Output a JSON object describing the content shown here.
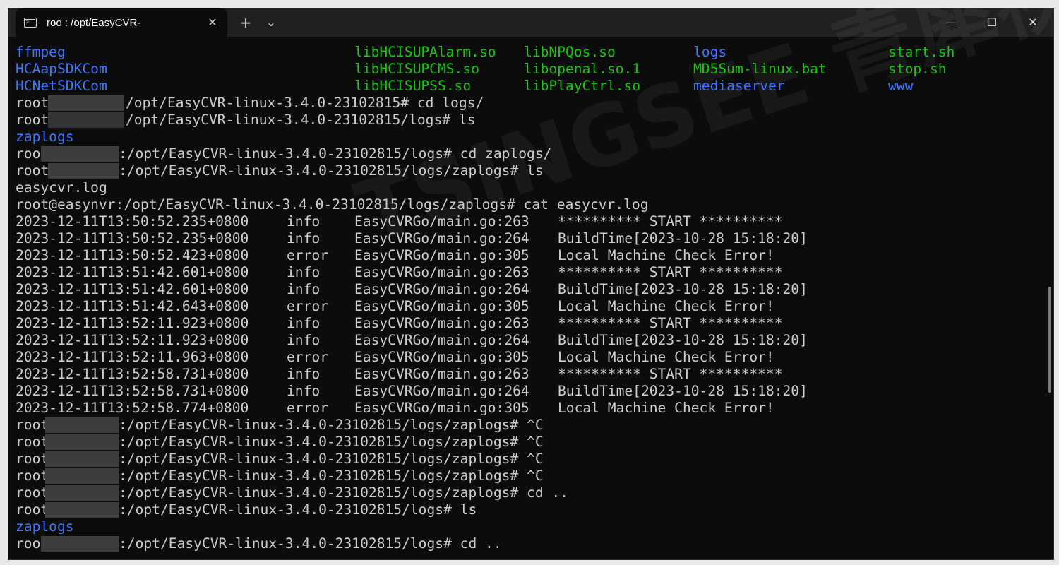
{
  "window": {
    "tab_title": "roo         : /opt/EasyCVR-",
    "new_tab": "+",
    "dropdown": "⌄",
    "tab_close": "✕",
    "minimize": "—",
    "maximize": "☐",
    "close": "✕"
  },
  "colors": {
    "background": "#0c0c0c",
    "titlebar": "#202020",
    "executable": "#16c60c",
    "directory": "#3b78ff",
    "text": "#cccccc"
  },
  "listing": [
    [
      "ffmpeg",
      "libHCISUPAlarm.so",
      "libNPQos.so",
      "logs",
      "start.sh"
    ],
    [
      "HCAapSDKCom",
      "libHCISUPCMS.so",
      "libopenal.so.1",
      "MD5Sum-linux.bat",
      "stop.sh"
    ],
    [
      "HCNetSDKCom",
      "libHCISUPSS.so",
      "libPlayCtrl.so",
      "mediaserver",
      "www"
    ]
  ],
  "prompt_lines_a": [
    {
      "user": "root",
      "rest": "/opt/EasyCVR-linux-3.4.0-23102815# cd logs/"
    },
    {
      "user": "root",
      "rest": "/opt/EasyCVR-linux-3.4.0-23102815/logs# ls"
    }
  ],
  "dir_zaplogs": "zaplogs",
  "prompt_lines_b": [
    {
      "user": "roo",
      "rest": ":/opt/EasyCVR-linux-3.4.0-23102815/logs# cd zaplogs/"
    },
    {
      "user": "root",
      "rest": ":/opt/EasyCVR-linux-3.4.0-23102815/logs/zaplogs# ls"
    }
  ],
  "file_easycvr": "easycvr.log",
  "cat_line": "root@easynvr:/opt/EasyCVR-linux-3.4.0-23102815/logs/zaplogs# cat easycvr.log",
  "log_entries": [
    {
      "ts": "2023-12-11T13:50:52.235+0800",
      "level": "info",
      "src": "EasyCVRGo/main.go:263",
      "msg": "********** START **********"
    },
    {
      "ts": "2023-12-11T13:50:52.235+0800",
      "level": "info",
      "src": "EasyCVRGo/main.go:264",
      "msg": "BuildTime[2023-10-28 15:18:20]"
    },
    {
      "ts": "2023-12-11T13:50:52.423+0800",
      "level": "error",
      "src": "EasyCVRGo/main.go:305",
      "msg": "Local Machine Check Error!"
    },
    {
      "ts": "2023-12-11T13:51:42.601+0800",
      "level": "info",
      "src": "EasyCVRGo/main.go:263",
      "msg": "********** START **********"
    },
    {
      "ts": "2023-12-11T13:51:42.601+0800",
      "level": "info",
      "src": "EasyCVRGo/main.go:264",
      "msg": "BuildTime[2023-10-28 15:18:20]"
    },
    {
      "ts": "2023-12-11T13:51:42.643+0800",
      "level": "error",
      "src": "EasyCVRGo/main.go:305",
      "msg": "Local Machine Check Error!"
    },
    {
      "ts": "2023-12-11T13:52:11.923+0800",
      "level": "info",
      "src": "EasyCVRGo/main.go:263",
      "msg": "********** START **********"
    },
    {
      "ts": "2023-12-11T13:52:11.923+0800",
      "level": "info",
      "src": "EasyCVRGo/main.go:264",
      "msg": "BuildTime[2023-10-28 15:18:20]"
    },
    {
      "ts": "2023-12-11T13:52:11.963+0800",
      "level": "error",
      "src": "EasyCVRGo/main.go:305",
      "msg": "Local Machine Check Error!"
    },
    {
      "ts": "2023-12-11T13:52:58.731+0800",
      "level": "info",
      "src": "EasyCVRGo/main.go:263",
      "msg": "********** START **********"
    },
    {
      "ts": "2023-12-11T13:52:58.731+0800",
      "level": "info",
      "src": "EasyCVRGo/main.go:264",
      "msg": "BuildTime[2023-10-28 15:18:20]"
    },
    {
      "ts": "2023-12-11T13:52:58.774+0800",
      "level": "error",
      "src": "EasyCVRGo/main.go:305",
      "msg": "Local Machine Check Error!"
    }
  ],
  "prompt_lines_c": [
    {
      "user": "root",
      "rest": ":/opt/EasyCVR-linux-3.4.0-23102815/logs/zaplogs# ^C"
    },
    {
      "user": "root",
      "rest": ":/opt/EasyCVR-linux-3.4.0-23102815/logs/zaplogs# ^C"
    },
    {
      "user": "root",
      "rest": ":/opt/EasyCVR-linux-3.4.0-23102815/logs/zaplogs# ^C"
    },
    {
      "user": "root",
      "rest": ":/opt/EasyCVR-linux-3.4.0-23102815/logs/zaplogs# ^C"
    },
    {
      "user": "root",
      "rest": ":/opt/EasyCVR-linux-3.4.0-23102815/logs/zaplogs# cd .."
    },
    {
      "user": "root",
      "rest": ":/opt/EasyCVR-linux-3.4.0-23102815/logs# ls"
    }
  ],
  "dir_zaplogs_2": "zaplogs",
  "last_prompt": {
    "user": "roo",
    "rest": ":/opt/EasyCVR-linux-3.4.0-23102815/logs# cd .."
  }
}
